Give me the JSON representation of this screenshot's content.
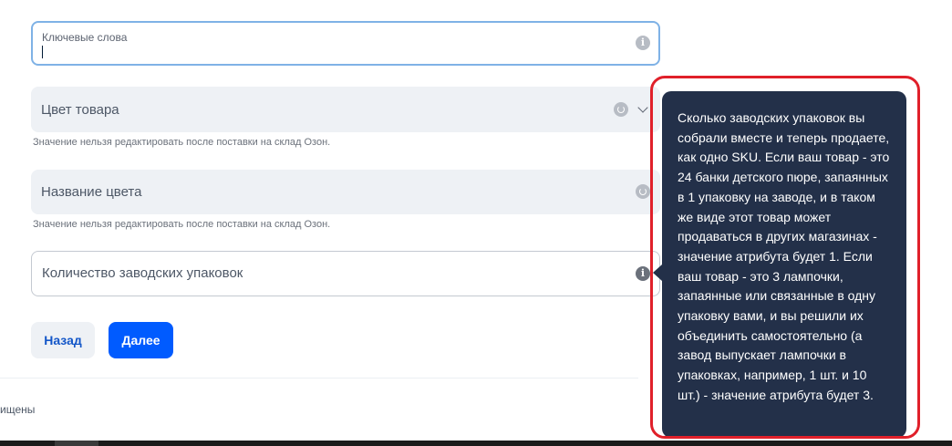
{
  "form": {
    "keywords": {
      "label": "Ключевые слова",
      "value": ""
    },
    "color": {
      "placeholder": "Цвет товара",
      "hint": "Значение нельзя редактировать после поставки на склад Озон."
    },
    "color_name": {
      "placeholder": "Название цвета",
      "hint": "Значение нельзя редактировать после поставки на склад Озон."
    },
    "factory_packages": {
      "placeholder": "Количество заводских упаковок"
    }
  },
  "buttons": {
    "back": "Назад",
    "next": "Далее"
  },
  "footer": {
    "text": "ищены"
  },
  "tooltip": {
    "text": "Сколько заводских упаковок вы собрали вместе и теперь продаете, как одно SKU. Если ваш товар - это 24 банки детского пюре, запаянных в 1 упаковку на заводе, и в таком же виде этот товар может продаваться в других магазинах - значение атрибута будет 1. Если ваш товар - это 3 лампочки, запаянные или связанные в одну упаковку вами, и вы решили их объединить самостоятельно (а завод выпускает лампочки в упаковках, например, 1 шт. и 10 шт.) - значение атрибута будет 3."
  },
  "icons": {
    "info": "info-icon",
    "sync": "sync-icon",
    "chevron": "chevron-down-icon"
  },
  "colors": {
    "primary": "#005bff",
    "tooltip_bg": "#233049",
    "annotation": "#e0202a",
    "focus_border": "#7fb2e6"
  }
}
